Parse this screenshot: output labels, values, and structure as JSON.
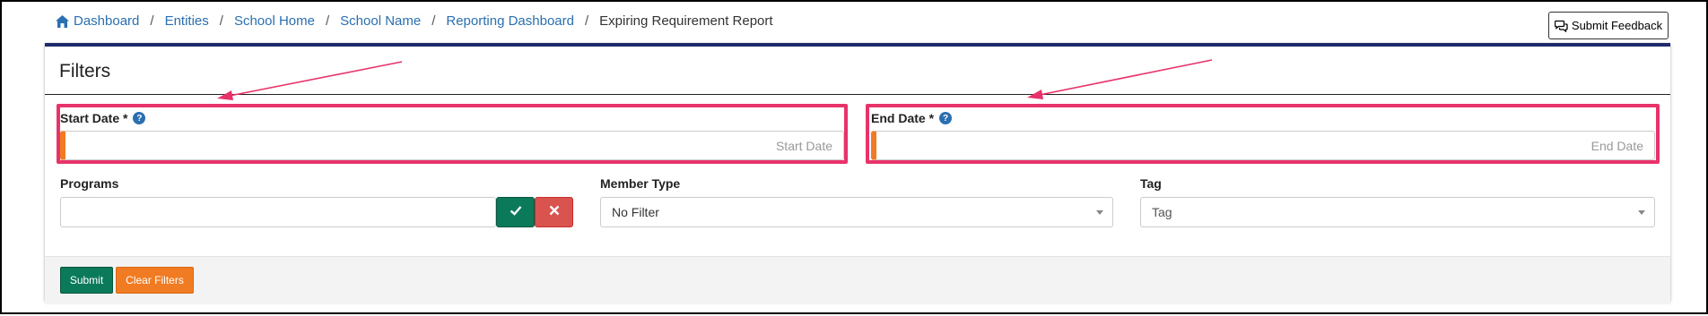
{
  "breadcrumb": {
    "items": [
      "Dashboard",
      "Entities",
      "School Home",
      "School Name",
      "Reporting Dashboard"
    ],
    "current": "Expiring Requirement Report",
    "separator": "/"
  },
  "feedback_button": {
    "label": "Submit Feedback",
    "icon": "chat-bubbles-icon"
  },
  "filters": {
    "title": "Filters",
    "start_date": {
      "label": "Start Date *",
      "help": "?",
      "placeholder": "Start Date",
      "value": ""
    },
    "end_date": {
      "label": "End Date *",
      "help": "?",
      "placeholder": "End Date",
      "value": ""
    },
    "programs": {
      "label": "Programs",
      "value": ""
    },
    "member_type": {
      "label": "Member Type",
      "selected": "No Filter"
    },
    "tag": {
      "label": "Tag",
      "selected": "Tag"
    }
  },
  "actions": {
    "submit_label": "Submit",
    "clear_label": "Clear Filters"
  },
  "colors": {
    "link": "#2a6fb0",
    "panel_top_border": "#1f2a6b",
    "required_marker": "#f07b22",
    "annotation": "#e8336a",
    "submit": "#0b7a5a",
    "clear": "#f07b22",
    "remove": "#d9534f"
  }
}
